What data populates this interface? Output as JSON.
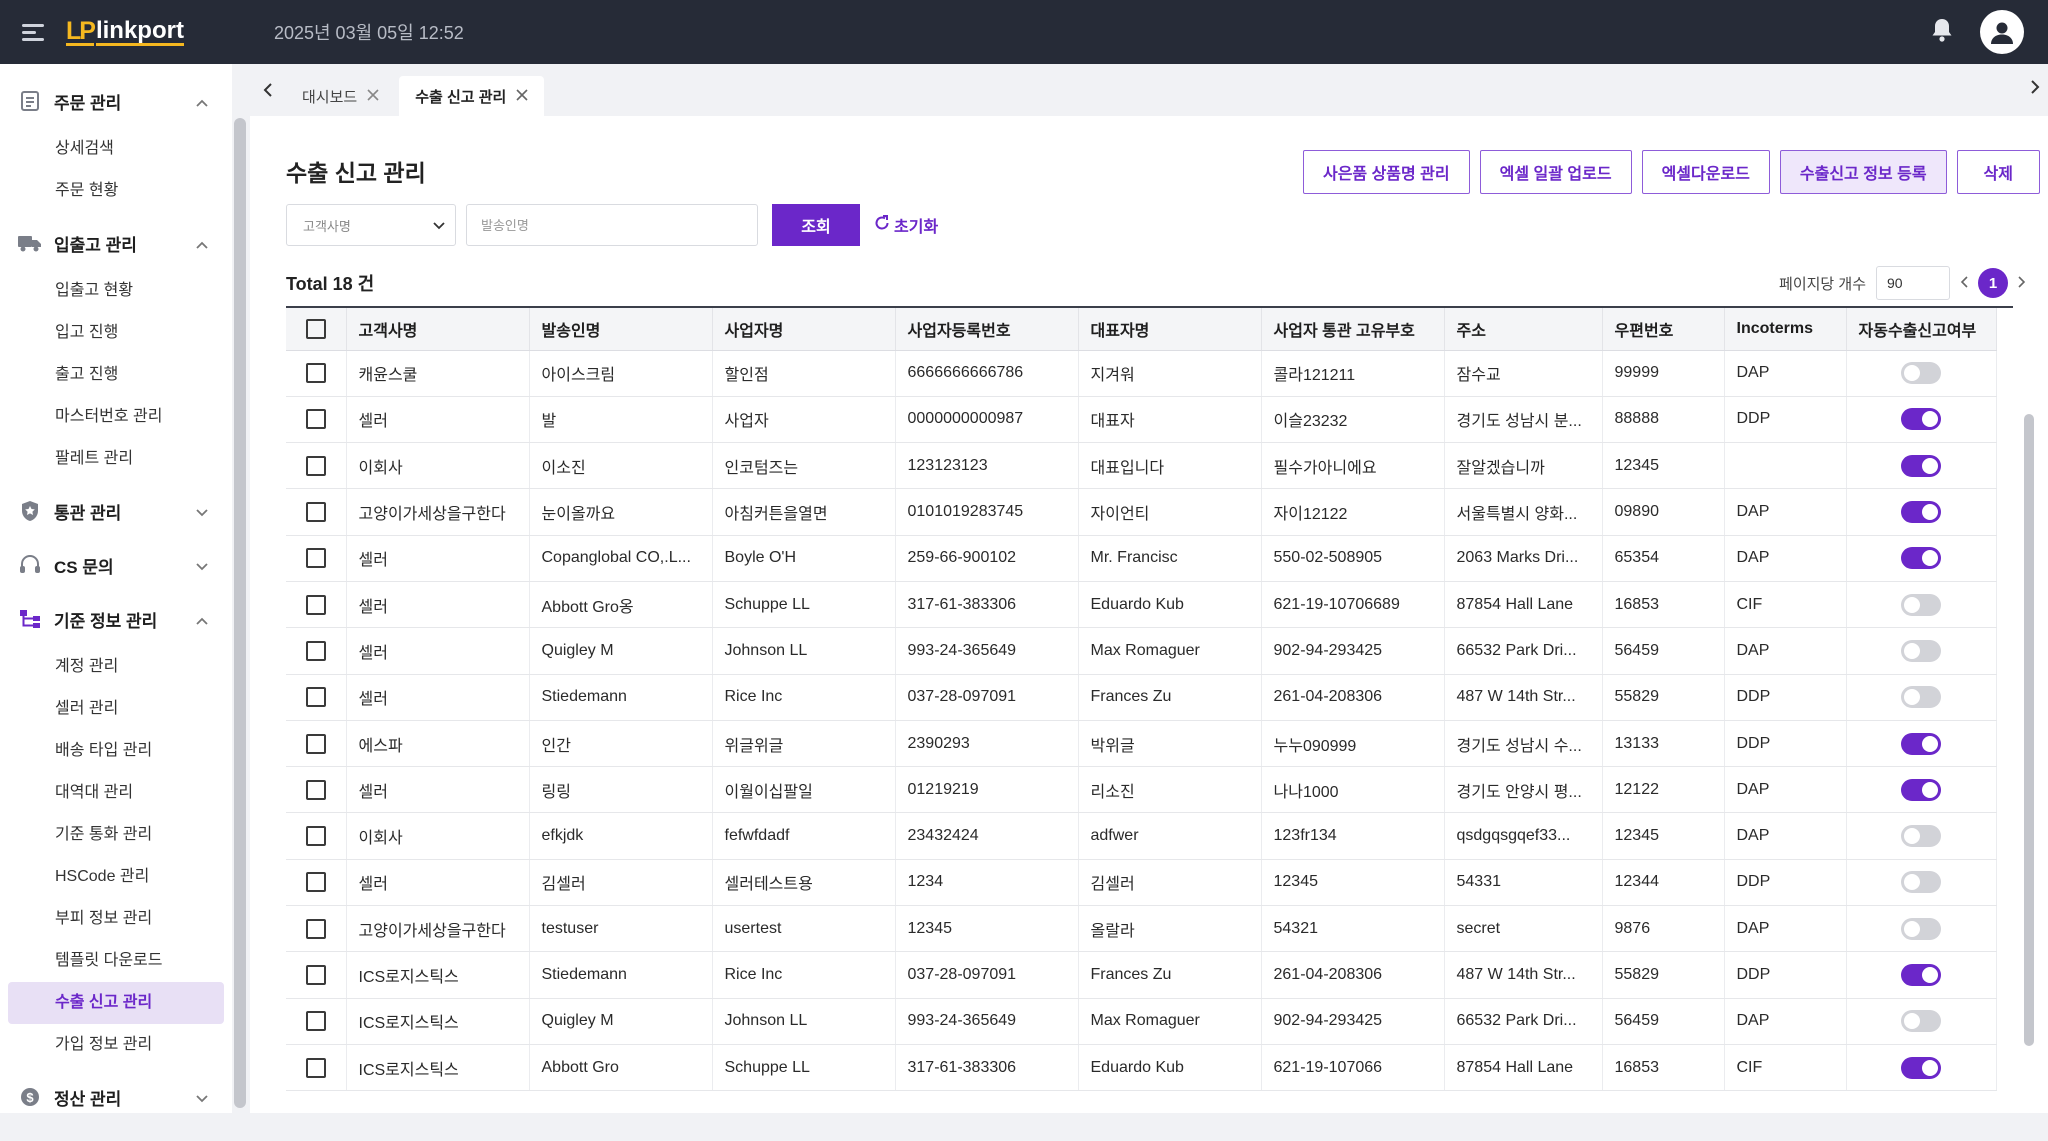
{
  "header": {
    "logo_mark": "LP",
    "logo_text": "linkport",
    "datetime": "2025년 03월 05일 12:52"
  },
  "sidebar": {
    "groups": [
      {
        "label": "주문 관리",
        "icon": "document-icon",
        "expanded": true,
        "items": [
          "상세검색",
          "주문 현황"
        ]
      },
      {
        "label": "입출고 관리",
        "icon": "truck-icon",
        "expanded": true,
        "items": [
          "입출고 현황",
          "입고 진행",
          "출고 진행",
          "마스터번호 관리",
          "팔레트 관리"
        ]
      },
      {
        "label": "통관 관리",
        "icon": "shield-icon",
        "expanded": false,
        "items": []
      },
      {
        "label": "CS 문의",
        "icon": "headset-icon",
        "expanded": false,
        "items": []
      },
      {
        "label": "기준 정보 관리",
        "icon": "hierarchy-icon",
        "expanded": true,
        "items": [
          "계정 관리",
          "셀러 관리",
          "배송 타입 관리",
          "대역대 관리",
          "기준 통화 관리",
          "HSCode 관리",
          "부피 정보 관리",
          "템플릿 다운로드",
          "수출 신고 관리",
          "가입 정보 관리"
        ]
      },
      {
        "label": "정산 관리",
        "icon": "dollar-icon",
        "expanded": false,
        "items": []
      }
    ],
    "active_item": "수출 신고 관리"
  },
  "tabs": [
    {
      "label": "대시보드",
      "active": false
    },
    {
      "label": "수출 신고 관리",
      "active": true
    }
  ],
  "page": {
    "title": "수출 신고 관리",
    "buttons": {
      "gift": "사은품 상품명 관리",
      "excel_upload": "엑셀 일괄 업로드",
      "excel_download": "엑셀다운로드",
      "register": "수출신고 정보 등록",
      "delete": "삭제"
    },
    "search": {
      "select_placeholder": "고객사명",
      "input_placeholder": "발송인명",
      "search_label": "조회",
      "reset_label": "초기화"
    },
    "total": "Total 18 건",
    "pager": {
      "per_page_label": "페이지당 개수",
      "per_page_value": "90",
      "current_page": "1"
    }
  },
  "colors": {
    "accent": "#6b27c9",
    "topbar": "#262b37"
  },
  "table": {
    "columns": [
      "고객사명",
      "발송인명",
      "사업자명",
      "사업자등록번호",
      "대표자명",
      "사업자 통관 고유부호",
      "주소",
      "우편번호",
      "Incoterms",
      "자동수출신고여부"
    ],
    "rows": [
      {
        "customer": "캐윤스쿨",
        "sender": "아이스크림",
        "biz": "할인점",
        "reg_no": "6666666666786",
        "ceo": "지겨워",
        "customs": "콜라121211",
        "address": "잠수교",
        "zip": "99999",
        "incoterms": "DAP",
        "auto": false
      },
      {
        "customer": "셀러",
        "sender": "발",
        "biz": "사업자",
        "reg_no": "0000000000987",
        "ceo": "대표자",
        "customs": "이슬23232",
        "address": "경기도 성남시 분...",
        "zip": "88888",
        "incoterms": "DDP",
        "auto": true
      },
      {
        "customer": "이회사",
        "sender": "이소진",
        "biz": "인코텀즈는",
        "reg_no": "123123123",
        "ceo": "대표입니다",
        "customs": "필수가아니에요",
        "address": "잘알겠습니까",
        "zip": "12345",
        "incoterms": "",
        "auto": true
      },
      {
        "customer": "고양이가세상을구한다",
        "sender": "눈이올까요",
        "biz": "아침커튼을열면",
        "reg_no": "0101019283745",
        "ceo": "자이언티",
        "customs": "자이12122",
        "address": "서울특별시 양화...",
        "zip": "09890",
        "incoterms": "DAP",
        "auto": true
      },
      {
        "customer": "셀러",
        "sender": "Copanglobal CO,.L...",
        "biz": "Boyle O'H",
        "reg_no": "259-66-900102",
        "ceo": "Mr. Francisc",
        "customs": "550-02-508905",
        "address": "2063 Marks Dri...",
        "zip": "65354",
        "incoterms": "DAP",
        "auto": true
      },
      {
        "customer": "셀러",
        "sender": "Abbott Gro옹",
        "biz": "Schuppe LL",
        "reg_no": "317-61-383306",
        "ceo": "Eduardo Kub",
        "customs": "621-19-10706689",
        "address": "87854 Hall Lane",
        "zip": "16853",
        "incoterms": "CIF",
        "auto": false
      },
      {
        "customer": "셀러",
        "sender": "Quigley M",
        "biz": "Johnson LL",
        "reg_no": "993-24-365649",
        "ceo": "Max Romaguer",
        "customs": "902-94-293425",
        "address": "66532 Park Dri...",
        "zip": "56459",
        "incoterms": "DAP",
        "auto": false
      },
      {
        "customer": "셀러",
        "sender": "Stiedemann",
        "biz": "Rice Inc",
        "reg_no": "037-28-097091",
        "ceo": "Frances Zu",
        "customs": "261-04-208306",
        "address": "487 W 14th Str...",
        "zip": "55829",
        "incoterms": "DDP",
        "auto": false
      },
      {
        "customer": "에스파",
        "sender": "인간",
        "biz": "위글위글",
        "reg_no": "2390293",
        "ceo": "박위글",
        "customs": "누누090999",
        "address": "경기도 성남시 수...",
        "zip": "13133",
        "incoterms": "DDP",
        "auto": true
      },
      {
        "customer": "셀러",
        "sender": "링링",
        "biz": "이월이십팔일",
        "reg_no": "01219219",
        "ceo": "리소진",
        "customs": "나나1000",
        "address": "경기도 안양시 평...",
        "zip": "12122",
        "incoterms": "DAP",
        "auto": true
      },
      {
        "customer": "이회사",
        "sender": "efkjdk",
        "biz": "fefwfdadf",
        "reg_no": "23432424",
        "ceo": "adfwer",
        "customs": "123fr134",
        "address": "qsdgqsgqef33...",
        "zip": "12345",
        "incoterms": "DAP",
        "auto": false
      },
      {
        "customer": "셀러",
        "sender": "김셀러",
        "biz": "셀러테스트용",
        "reg_no": "1234",
        "ceo": "김셀러",
        "customs": "12345",
        "address": "54331",
        "zip": "12344",
        "incoterms": "DDP",
        "auto": false
      },
      {
        "customer": "고양이가세상을구한다",
        "sender": "testuser",
        "biz": "usertest",
        "reg_no": "12345",
        "ceo": "올랄라",
        "customs": "54321",
        "address": "secret",
        "zip": "9876",
        "incoterms": "DAP",
        "auto": false
      },
      {
        "customer": "ICS로지스틱스",
        "sender": "Stiedemann",
        "biz": "Rice Inc",
        "reg_no": "037-28-097091",
        "ceo": "Frances Zu",
        "customs": "261-04-208306",
        "address": "487 W 14th Str...",
        "zip": "55829",
        "incoterms": "DDP",
        "auto": true
      },
      {
        "customer": "ICS로지스틱스",
        "sender": "Quigley M",
        "biz": "Johnson LL",
        "reg_no": "993-24-365649",
        "ceo": "Max Romaguer",
        "customs": "902-94-293425",
        "address": "66532 Park Dri...",
        "zip": "56459",
        "incoterms": "DAP",
        "auto": false
      },
      {
        "customer": "ICS로지스틱스",
        "sender": "Abbott Gro",
        "biz": "Schuppe LL",
        "reg_no": "317-61-383306",
        "ceo": "Eduardo Kub",
        "customs": "621-19-107066",
        "address": "87854 Hall Lane",
        "zip": "16853",
        "incoterms": "CIF",
        "auto": true
      }
    ]
  }
}
